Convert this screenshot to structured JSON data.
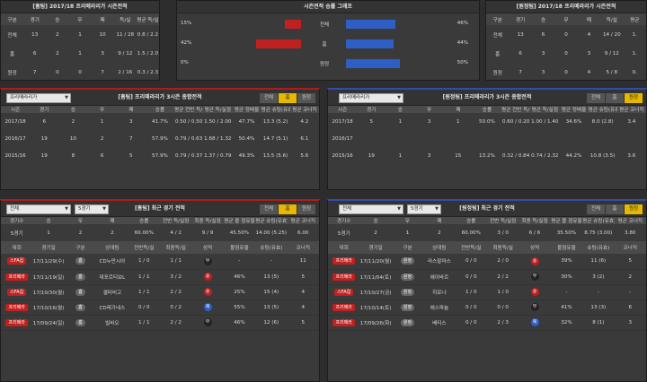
{
  "home_season": {
    "title": "[홈팀] 2017/18 프리메라리가 시즌전적",
    "headers": [
      "구분",
      "경기",
      "승",
      "무",
      "패",
      "득/실",
      "평균 득/실"
    ],
    "rows": [
      [
        "전체",
        "13",
        "2",
        "1",
        "10",
        "11 / 28",
        "0.8 / 2.2"
      ],
      [
        "홈",
        "6",
        "2",
        "1",
        "3",
        "9 / 12",
        "1.5 / 2.0"
      ],
      [
        "원정",
        "7",
        "0",
        "0",
        "7",
        "2 / 16",
        "0.3 / 2.3"
      ]
    ]
  },
  "graph": {
    "title": "시즌전적 승률 그래프",
    "rows": [
      {
        "label": "전체",
        "home_pct": "15%",
        "away_pct": "46%",
        "home": 15,
        "away": 46
      },
      {
        "label": "홈",
        "home_pct": "42%",
        "away_pct": "44%",
        "home": 42,
        "away": 44
      },
      {
        "label": "원정",
        "home_pct": "0%",
        "away_pct": "50%",
        "home": 0,
        "away": 50
      }
    ],
    "home_color": "#c0201f",
    "away_color": "#2e5fc7"
  },
  "away_season": {
    "title": "[원정팀] 2017/18 프리메라리가 시즌전적",
    "headers": [
      "구분",
      "경기",
      "승",
      "무",
      "패",
      "득/실",
      "평균"
    ],
    "rows": [
      [
        "전체",
        "13",
        "6",
        "0",
        "4",
        "14 / 20",
        "1."
      ],
      [
        "홈",
        "6",
        "3",
        "0",
        "3",
        "9 / 12",
        "1."
      ],
      [
        "원정",
        "7",
        "3",
        "0",
        "4",
        "5 / 8",
        "0."
      ]
    ]
  },
  "home_3season": {
    "select": "프리메라리가",
    "title": "[홈팀] 프리메라리가 3시즌 종합전적",
    "tabs": [
      "전체",
      "홈",
      "원정"
    ],
    "headers": [
      "시즌",
      "경기",
      "승",
      "무",
      "패",
      "승률",
      "평균 전반 득/실점",
      "평균 득/실점",
      "평균 정배율",
      "평균 슈팅(유효)",
      "평균 코너킥"
    ],
    "rows": [
      [
        "2017/18",
        "6",
        "2",
        "1",
        "3",
        "41.7%",
        "0.50 / 0.50",
        "1.50 / 2.00",
        "47.7%",
        "13.3 (5.2)",
        "4.2"
      ],
      [
        "2016/17",
        "19",
        "10",
        "2",
        "7",
        "57.9%",
        "0.79 / 0.63",
        "1.68 / 1.32",
        "50.4%",
        "14.7 (5.1)",
        "6.1"
      ],
      [
        "2015/16",
        "19",
        "8",
        "6",
        "5",
        "57.9%",
        "0.79 / 0.37",
        "1.37 / 0.79",
        "49.3%",
        "13.5 (5.6)",
        "5.6"
      ]
    ]
  },
  "away_3season": {
    "select": "프리메라리가",
    "title": "[원정팀] 프리메라리가 3시즌 종합전적",
    "tabs": [
      "전체",
      "홈",
      "원정"
    ],
    "headers": [
      "시즌",
      "경기",
      "승",
      "무",
      "패",
      "승률",
      "평균 전반 득/실점",
      "평균 득/실점",
      "평균 정배율",
      "평균 슈팅(유효)",
      "평균 코너킥"
    ],
    "rows": [
      [
        "2017/18",
        "5",
        "1",
        "3",
        "1",
        "50.0%",
        "0.60 / 0.20",
        "1.00 / 1.40",
        "34.6%",
        "8.0 (2.8)",
        "3.4"
      ],
      [
        "2016/17",
        "",
        "",
        "",
        "",
        "",
        "",
        "",
        "",
        "",
        ""
      ],
      [
        "2015/16",
        "19",
        "1",
        "3",
        "15",
        "13.2%",
        "0.32 / 0.84",
        "0.74 / 2.32",
        "44.2%",
        "10.8 (3.5)",
        "3.6"
      ]
    ]
  },
  "home_recent": {
    "select1": "전체",
    "select2": "5경기",
    "title": "[홈팀] 최근 경기 전적",
    "tabs": [
      "전체",
      "홈",
      "원정"
    ],
    "sum_headers": [
      "경기수",
      "승",
      "무",
      "패",
      "승률",
      "전반 득/실점",
      "최종 득/실점",
      "평균 볼 점유율",
      "평균 슈팅(유효)",
      "평균 코너킥"
    ],
    "sum_row": [
      "5경기",
      "1",
      "2",
      "2",
      "60.00%",
      "4 / 2",
      "9 / 9",
      "45.50%",
      "14.00 (5.25)",
      "6.00"
    ],
    "headers": [
      "대회",
      "경기일",
      "구분",
      "상대팀",
      "전반득/실",
      "최종득/실",
      "성적",
      "볼점유율",
      "슈팅(유효)",
      "코너킥"
    ],
    "rows": [
      {
        "league": "스FA컵",
        "date": "17/11/29(수)",
        "side": "홈",
        "opp": "CD누만시아",
        "half": "1 / 0",
        "full": "1 / 1",
        "res": "무",
        "rc": "D",
        "poss": "-",
        "shot": "-",
        "corner": "11"
      },
      {
        "league": "프리메라",
        "date": "17/11/19(일)",
        "side": "홈",
        "opp": "데포르티보L",
        "half": "1 / 1",
        "full": "3 / 2",
        "res": "승",
        "rc": "W",
        "poss": "46%",
        "shot": "13 (5)",
        "corner": "5"
      },
      {
        "league": "스FA컵",
        "date": "17/10/30(월)",
        "side": "홈",
        "opp": "셀타비고",
        "half": "1 / 1",
        "full": "2 / 2",
        "res": "승",
        "rc": "W",
        "poss": "25%",
        "shot": "15 (4)",
        "corner": "4"
      },
      {
        "league": "프리메라",
        "date": "17/10/16(월)",
        "side": "홈",
        "opp": "CD레가네스",
        "half": "0 / 0",
        "full": "0 / 2",
        "res": "패",
        "rc": "L",
        "poss": "55%",
        "shot": "13 (5)",
        "corner": "4"
      },
      {
        "league": "프리메라",
        "date": "17/09/24(일)",
        "side": "홈",
        "opp": "빌바오",
        "half": "1 / 1",
        "full": "2 / 2",
        "res": "무",
        "rc": "D",
        "poss": "46%",
        "shot": "12 (6)",
        "corner": "5"
      }
    ]
  },
  "away_recent": {
    "select1": "전체",
    "select2": "5경기",
    "title": "[원정팀] 최근 경기 전적",
    "tabs": [
      "전체",
      "홈",
      "원정"
    ],
    "sum_headers": [
      "경기수",
      "승",
      "무",
      "패",
      "승률",
      "전반 득/실점",
      "최종 득/실점",
      "평균 볼 점유율",
      "평균 슈팅(유효)",
      "평균 코너킥"
    ],
    "sum_row": [
      "5경기",
      "2",
      "1",
      "2",
      "60.00%",
      "3 / 0",
      "6 / 6",
      "35.50%",
      "8.75 (3.00)",
      "3.80"
    ],
    "headers": [
      "대회",
      "경기일",
      "구분",
      "상대팀",
      "전반득/실",
      "최종득/실",
      "성적",
      "볼점유율",
      "슈팅(유효)",
      "코너킥"
    ],
    "rows": [
      {
        "league": "프리메라",
        "date": "17/11/20(월)",
        "side": "원정",
        "opp": "라스팔마스",
        "half": "0 / 0",
        "full": "2 / 0",
        "res": "승",
        "rc": "W",
        "poss": "39%",
        "shot": "11 (6)",
        "corner": "5"
      },
      {
        "league": "프리메라",
        "date": "17/11/04(토)",
        "side": "원정",
        "opp": "헤이바르",
        "half": "0 / 0",
        "full": "2 / 2",
        "res": "무",
        "rc": "D",
        "poss": "30%",
        "shot": "3 (2)",
        "corner": "2"
      },
      {
        "league": "스FA컵",
        "date": "17/10/27(금)",
        "side": "원정",
        "opp": "히로나",
        "half": "1 / 0",
        "full": "1 / 0",
        "res": "승",
        "rc": "W",
        "poss": "-",
        "shot": "-",
        "corner": "-"
      },
      {
        "league": "프리메라",
        "date": "17/10/14(토)",
        "side": "원정",
        "opp": "에스파뇰",
        "half": "0 / 0",
        "full": "0 / 0",
        "res": "무",
        "rc": "D",
        "poss": "41%",
        "shot": "13 (3)",
        "corner": "6"
      },
      {
        "league": "프리메라",
        "date": "17/09/26(화)",
        "side": "원정",
        "opp": "베티스",
        "half": "0 / 0",
        "full": "2 / 3",
        "res": "패",
        "rc": "L",
        "poss": "32%",
        "shot": "8 (1)",
        "corner": "3"
      }
    ]
  }
}
